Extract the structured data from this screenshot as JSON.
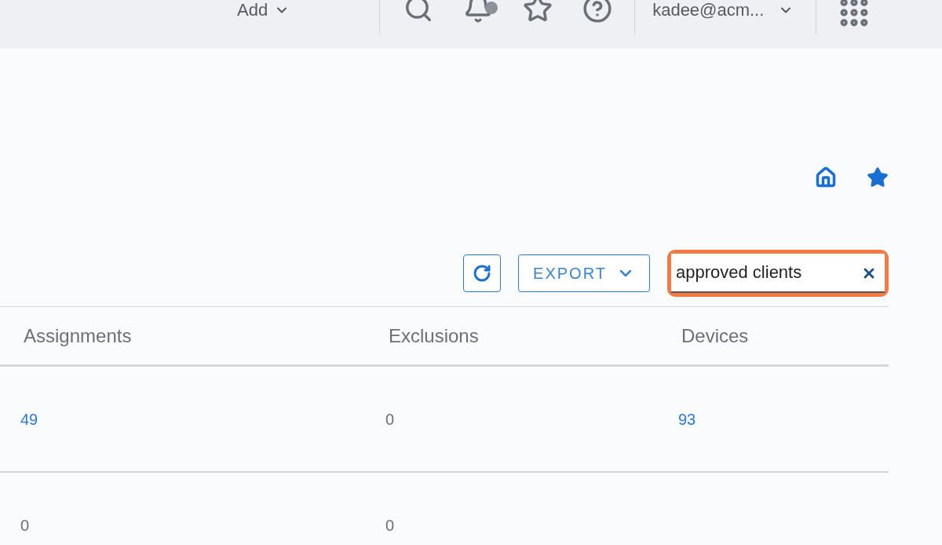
{
  "top_bar": {
    "add_menu": "Add",
    "user": "kadee@acm...",
    "notification_dot": true
  },
  "toolbar": {
    "export": "EXPORT",
    "search": {
      "value": "approved clients",
      "highlighted": true
    }
  },
  "table": {
    "columns": [
      "Assignments",
      "Exclusions",
      "Devices"
    ],
    "rows": [
      {
        "cells": [
          {
            "text": "49",
            "kind": "link"
          },
          {
            "text": "0",
            "kind": "plain"
          },
          {
            "text": "93",
            "kind": "link"
          }
        ]
      },
      {
        "cells": [
          {
            "text": "0",
            "kind": "plain"
          },
          {
            "text": "0",
            "kind": "plain"
          }
        ]
      }
    ]
  }
}
